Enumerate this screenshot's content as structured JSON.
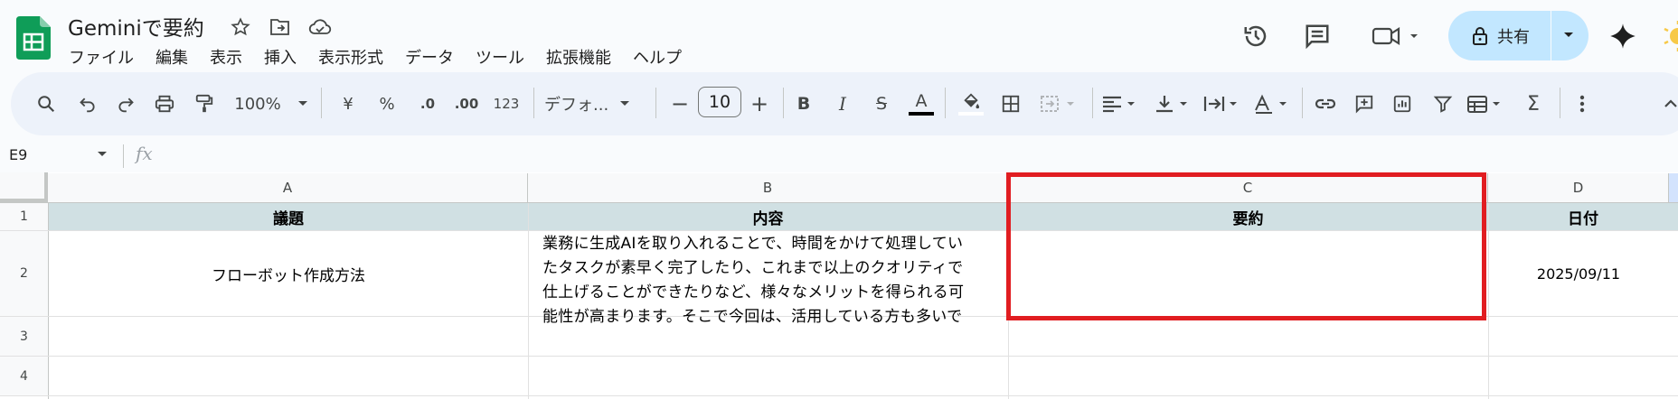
{
  "doc": {
    "title": "Geminiで要約"
  },
  "menu": [
    "ファイル",
    "編集",
    "表示",
    "挿入",
    "表示形式",
    "データ",
    "ツール",
    "拡張機能",
    "ヘルプ"
  ],
  "share": {
    "label": "共有"
  },
  "toolbar": {
    "zoom": "100%",
    "currency": "¥",
    "percent": "%",
    "decimal_dec": ".0",
    "decimal_inc": ".00",
    "number_format": "123",
    "font": "デフォ...",
    "font_size": "10",
    "minus": "−",
    "plus": "+",
    "bold": "B",
    "italic": "I",
    "strike": "S",
    "text_color": "A",
    "sigma": "Σ"
  },
  "formula_bar": {
    "name_box": "E9",
    "fx": "fx",
    "value": ""
  },
  "grid": {
    "columns": [
      "A",
      "B",
      "C",
      "D"
    ],
    "rows": [
      "1",
      "2",
      "3",
      "4"
    ],
    "headers": {
      "A": "議題",
      "B": "内容",
      "C": "要約",
      "D": "日付"
    },
    "row2": {
      "A": "フローボット作成方法",
      "B_lines": [
        "業務に生成AIを取り入れることで、時間をかけて処理してい",
        "たタスクが素早く完了したり、これまで以上のクオリティで",
        "仕上げることができたりなど、様々なメリットを得られる可",
        "能性が高まります。そこで今回は、活用している方も多いで"
      ],
      "C": "",
      "D": "2025/09/11"
    }
  },
  "colors": {
    "accent": "#c2e7ff",
    "highlight": "#e11d21",
    "header_fill": "#d0e0e3",
    "sheets_green": "#0f9d58"
  }
}
